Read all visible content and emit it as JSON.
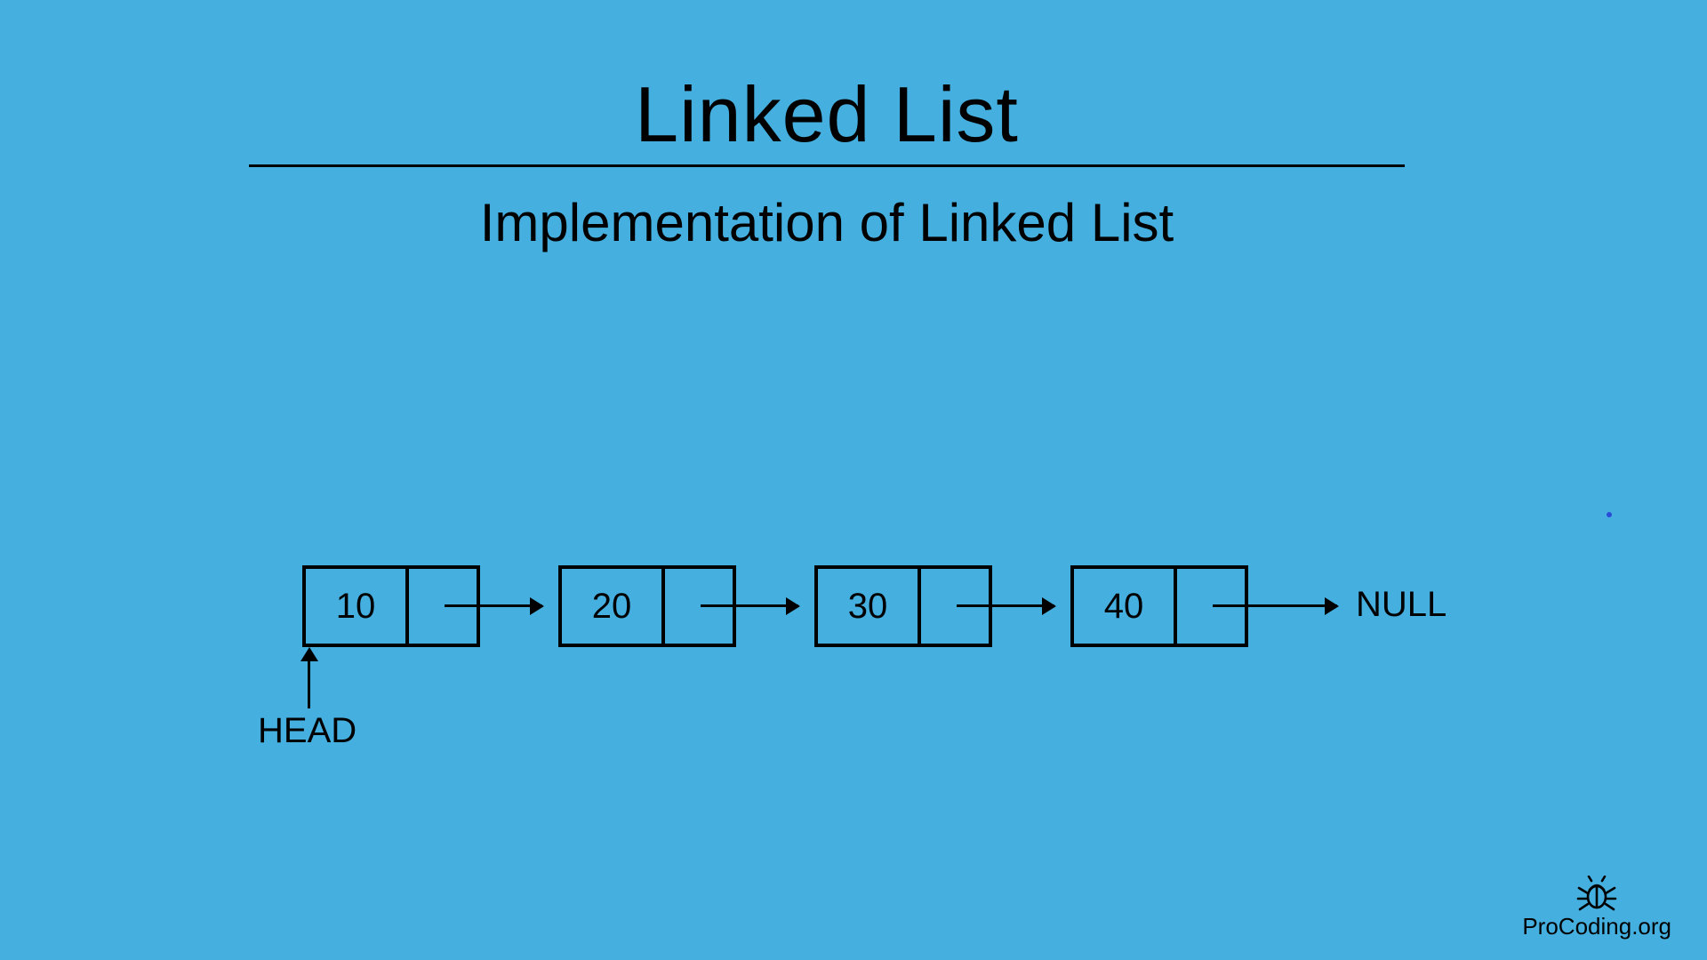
{
  "header": {
    "title": "Linked List",
    "subtitle": "Implementation of Linked List"
  },
  "linkedList": {
    "headLabel": "HEAD",
    "nullLabel": "NULL",
    "nodes": [
      {
        "value": "10"
      },
      {
        "value": "20"
      },
      {
        "value": "30"
      },
      {
        "value": "40"
      }
    ]
  },
  "brand": {
    "name": "ProCoding.org"
  }
}
